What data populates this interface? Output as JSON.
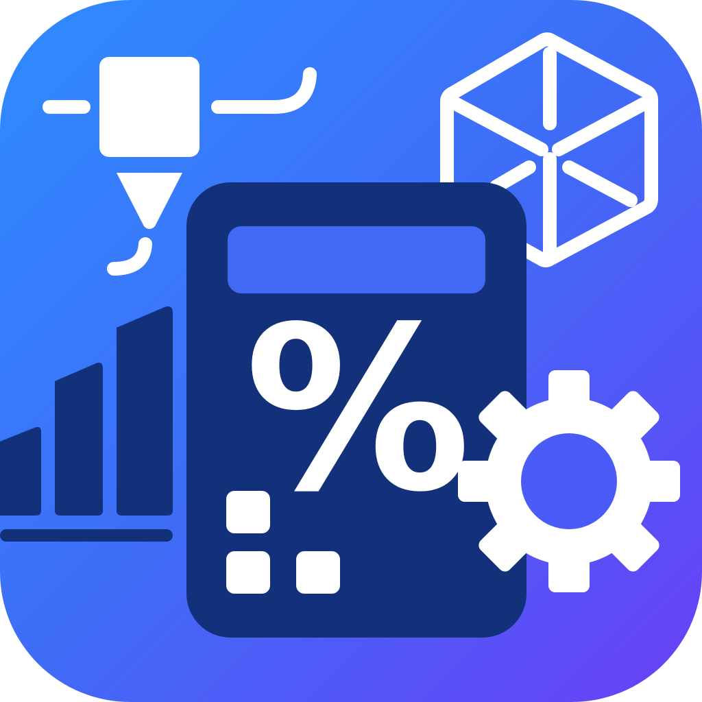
{
  "icon": {
    "symbol": "%",
    "colors": {
      "gradient_start": "#2f8cff",
      "gradient_mid": "#3f6cf7",
      "gradient_end": "#6a3ff7",
      "navy": "#13307a",
      "screen": "#4169f5",
      "white": "#ffffff"
    },
    "elements": [
      "3d-printer-nozzle-icon",
      "cube-icon",
      "bar-chart-icon",
      "calculator-icon",
      "percent-icon",
      "gear-icon"
    ]
  }
}
